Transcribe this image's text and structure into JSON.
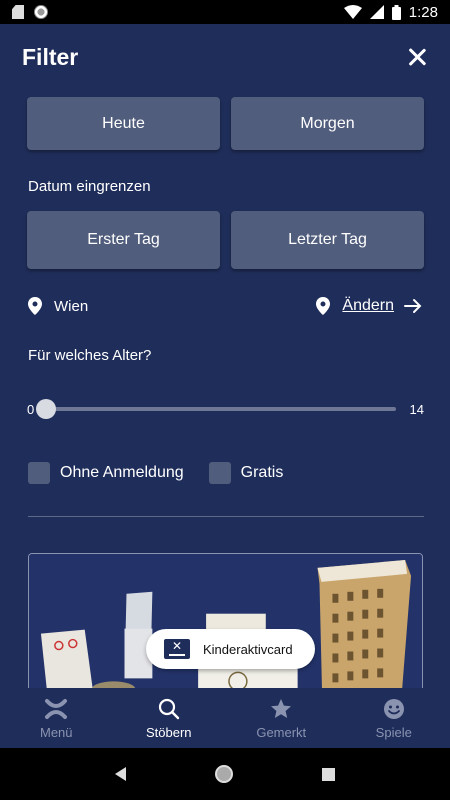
{
  "status": {
    "time": "1:28"
  },
  "header": {
    "title": "Filter"
  },
  "quick_dates": {
    "today_label": "Heute",
    "tomorrow_label": "Morgen"
  },
  "date_range": {
    "label": "Datum eingrenzen",
    "first_day_label": "Erster Tag",
    "last_day_label": "Letzter Tag"
  },
  "location": {
    "city": "Wien",
    "change_label": "Ändern"
  },
  "age": {
    "label": "Für welches Alter?",
    "min": "0",
    "max": "14",
    "selected_min": 0
  },
  "options": {
    "no_registration_label": "Ohne Anmeldung",
    "free_label": "Gratis"
  },
  "chip": {
    "label": "Kinderaktivcard"
  },
  "bottom_nav": {
    "items": [
      {
        "label": "Menü",
        "icon": "x-logo-icon"
      },
      {
        "label": "Stöbern",
        "icon": "search-icon"
      },
      {
        "label": "Gemerkt",
        "icon": "star-icon"
      },
      {
        "label": "Spiele",
        "icon": "smiley-icon"
      }
    ],
    "active": "Stöbern"
  },
  "colors": {
    "background": "#1f2d5a",
    "button": "#515d7c",
    "active_nav": "#ffffff",
    "inactive_nav": "#8a93b0"
  }
}
